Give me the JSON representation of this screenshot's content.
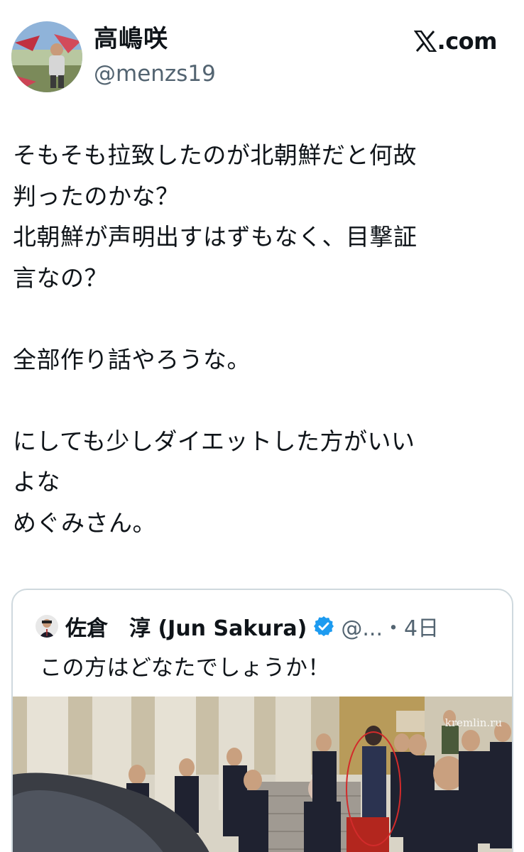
{
  "post": {
    "author": {
      "display_name": "高嶋咲",
      "handle": "@menzs19",
      "avatar_icon": "avatar-photo-icon"
    },
    "source": {
      "label": ".com",
      "logo_icon": "x-logo-icon"
    },
    "text": "そもそも拉致したのが北朝鮮だと何故\n判ったのかな？\n北朝鮮が声明出すはずもなく、目撃証\n言なの？\n\n全部作り話やろうな。\n\nにしても少しダイエットした方がいい\nよな\nめぐみさん。"
  },
  "quote": {
    "author": {
      "display_name": "佐倉　淳 (Jun Sakura)",
      "verified_icon": "verified-badge-icon",
      "meta": "@...・4日"
    },
    "text": "この方はどなたでしょうか！",
    "media": {
      "watermark": "kremlin.ru"
    }
  },
  "colors": {
    "text": "#0f1419",
    "secondary": "#536471",
    "border": "#cfd9de",
    "verified": "#1d9bf0"
  }
}
